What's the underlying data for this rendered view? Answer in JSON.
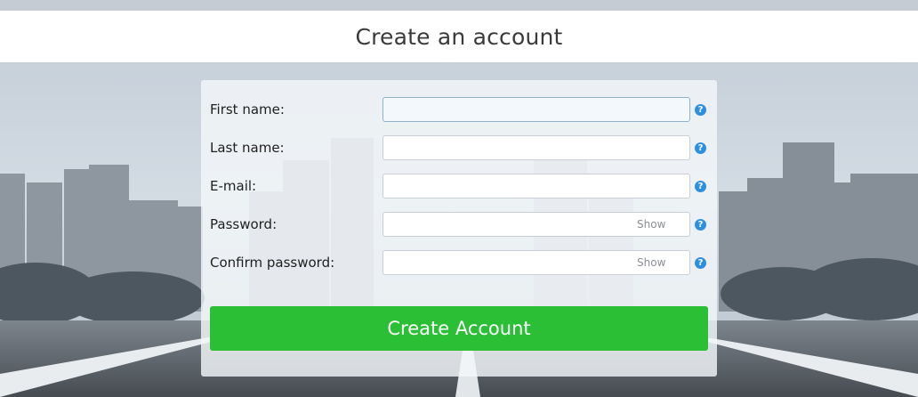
{
  "header": {
    "title": "Create an account"
  },
  "form": {
    "fields": [
      {
        "label": "First name:",
        "value": "",
        "has_show_toggle": false
      },
      {
        "label": "Last name:",
        "value": "",
        "has_show_toggle": false
      },
      {
        "label": "E-mail:",
        "value": "",
        "has_show_toggle": false
      },
      {
        "label": "Password:",
        "value": "",
        "has_show_toggle": true,
        "show_label": "Show"
      },
      {
        "label": "Confirm password:",
        "value": "",
        "has_show_toggle": true,
        "show_label": "Show"
      }
    ],
    "help_glyph": "?",
    "submit_label": "Create Account"
  },
  "colors": {
    "header_background": "#ffffff",
    "submit_button": "#2bbf35",
    "help_icon": "#2d8fe0",
    "focused_input_background": "#f2f8fc"
  },
  "icons": {
    "help": "question-circle-icon",
    "background": "city-road-photo"
  }
}
